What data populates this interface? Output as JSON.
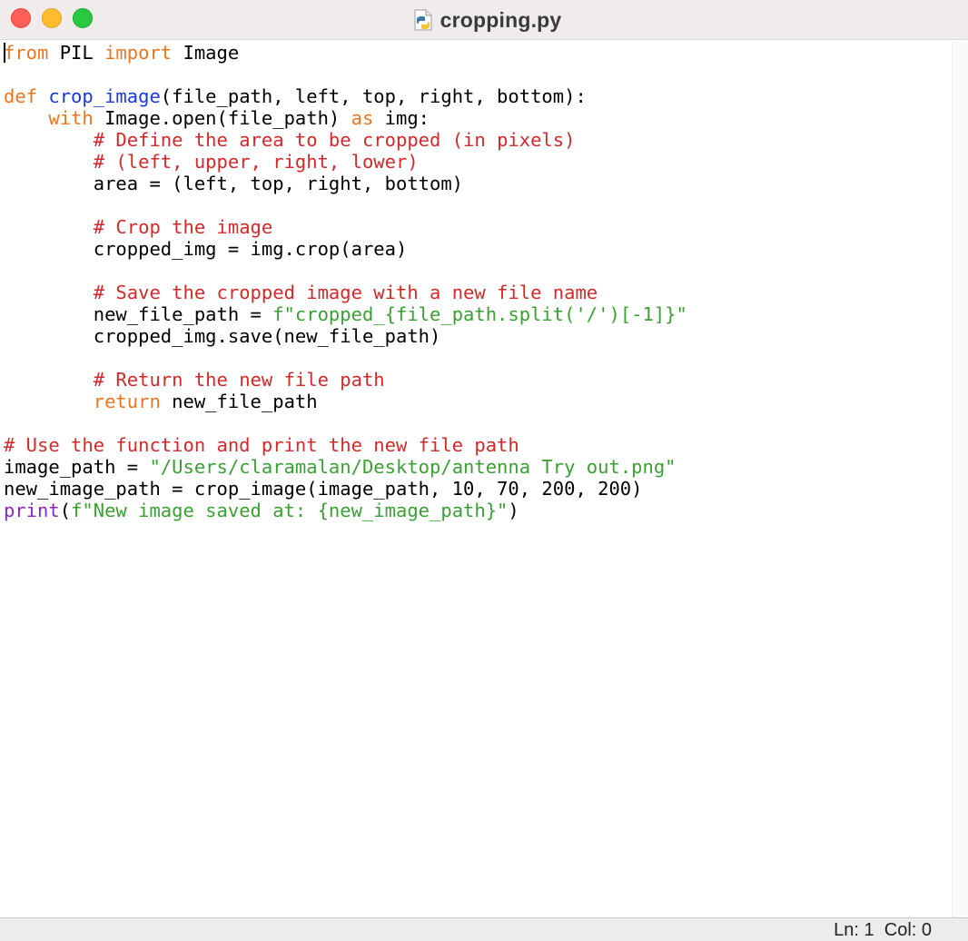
{
  "window": {
    "title": "cropping.py",
    "file_icon": "python-file-icon"
  },
  "editor": {
    "lines": [
      [
        {
          "t": "kw",
          "v": "from"
        },
        {
          "t": "pl",
          "v": " PIL "
        },
        {
          "t": "kw",
          "v": "import"
        },
        {
          "t": "pl",
          "v": " Image"
        }
      ],
      [],
      [
        {
          "t": "kw",
          "v": "def"
        },
        {
          "t": "pl",
          "v": " "
        },
        {
          "t": "fn",
          "v": "crop_image"
        },
        {
          "t": "pl",
          "v": "(file_path, left, top, right, bottom):"
        }
      ],
      [
        {
          "t": "pl",
          "v": "    "
        },
        {
          "t": "kw",
          "v": "with"
        },
        {
          "t": "pl",
          "v": " Image.open(file_path) "
        },
        {
          "t": "kw",
          "v": "as"
        },
        {
          "t": "pl",
          "v": " img:"
        }
      ],
      [
        {
          "t": "pl",
          "v": "        "
        },
        {
          "t": "cm",
          "v": "# Define the area to be cropped (in pixels)"
        }
      ],
      [
        {
          "t": "pl",
          "v": "        "
        },
        {
          "t": "cm",
          "v": "# (left, upper, right, lower)"
        }
      ],
      [
        {
          "t": "pl",
          "v": "        area = (left, top, right, bottom)"
        }
      ],
      [],
      [
        {
          "t": "pl",
          "v": "        "
        },
        {
          "t": "cm",
          "v": "# Crop the image"
        }
      ],
      [
        {
          "t": "pl",
          "v": "        cropped_img = img.crop(area)"
        }
      ],
      [],
      [
        {
          "t": "pl",
          "v": "        "
        },
        {
          "t": "cm",
          "v": "# Save the cropped image with a new file name"
        }
      ],
      [
        {
          "t": "pl",
          "v": "        new_file_path = "
        },
        {
          "t": "st",
          "v": "f\"cropped_{file_path.split('/')[-1]}\""
        }
      ],
      [
        {
          "t": "pl",
          "v": "        cropped_img.save(new_file_path)"
        }
      ],
      [],
      [
        {
          "t": "pl",
          "v": "        "
        },
        {
          "t": "cm",
          "v": "# Return the new file path"
        }
      ],
      [
        {
          "t": "pl",
          "v": "        "
        },
        {
          "t": "kw",
          "v": "return"
        },
        {
          "t": "pl",
          "v": " new_file_path"
        }
      ],
      [],
      [
        {
          "t": "cm",
          "v": "# Use the function and print the new file path"
        }
      ],
      [
        {
          "t": "pl",
          "v": "image_path = "
        },
        {
          "t": "st",
          "v": "\"/Users/claramalan/Desktop/antenna Try out.png\""
        }
      ],
      [
        {
          "t": "pl",
          "v": "new_image_path = crop_image(image_path, 10, 70, 200, 200)"
        }
      ],
      [
        {
          "t": "bi",
          "v": "print"
        },
        {
          "t": "pl",
          "v": "("
        },
        {
          "t": "st",
          "v": "f\"New image saved at: {new_image_path}\""
        },
        {
          "t": "pl",
          "v": ")"
        }
      ]
    ]
  },
  "status": {
    "text": "Ln: 1  Col: 0"
  },
  "colors": {
    "keyword": "#e8761e",
    "function": "#1a3ad8",
    "comment": "#d12a2a",
    "string": "#3aa033",
    "builtin": "#8b2ab5"
  }
}
